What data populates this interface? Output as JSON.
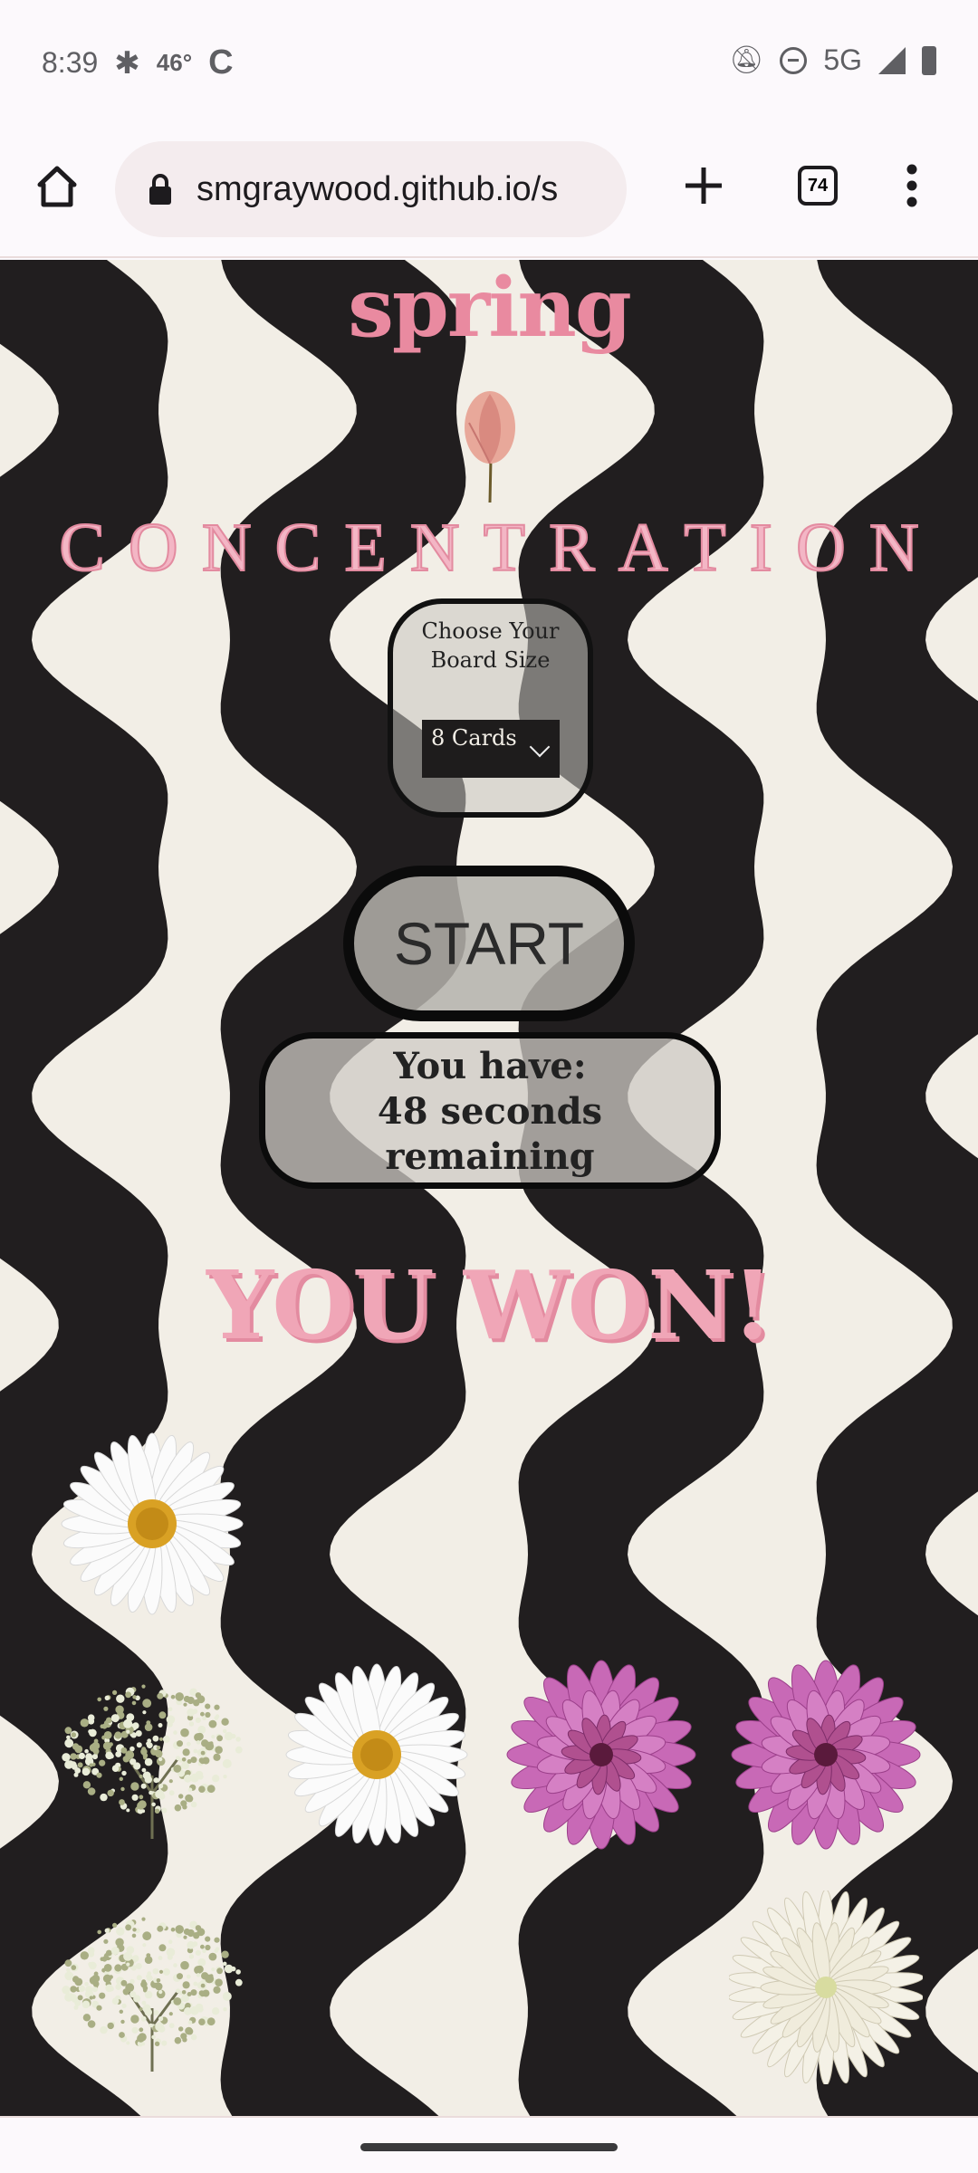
{
  "status_bar": {
    "time": "8:39",
    "temperature": "46°",
    "network": "5G"
  },
  "browser": {
    "url": "smgraywood.github.io/s",
    "tab_count": "74"
  },
  "game": {
    "title": "spring",
    "heading": "CONCENTRATION",
    "board_label_line1": "Choose Your",
    "board_label_line2": "Board Size",
    "board_size_selected": "8 Cards",
    "start_label": "START",
    "timer_line1": "You have:",
    "timer_line2": "48 seconds",
    "timer_line3": "remaining",
    "result": "YOU WON!",
    "cards": [
      {
        "flower": "daisy",
        "row": 1,
        "col": 1
      },
      {
        "flower": "babys-breath",
        "row": 2,
        "col": 1
      },
      {
        "flower": "daisy",
        "row": 2,
        "col": 2
      },
      {
        "flower": "dahlia",
        "row": 2,
        "col": 3
      },
      {
        "flower": "dahlia",
        "row": 2,
        "col": 4
      },
      {
        "flower": "babys-breath",
        "row": 3,
        "col": 1
      },
      {
        "flower": "chrysanthemum",
        "row": 3,
        "col": 4
      }
    ]
  }
}
